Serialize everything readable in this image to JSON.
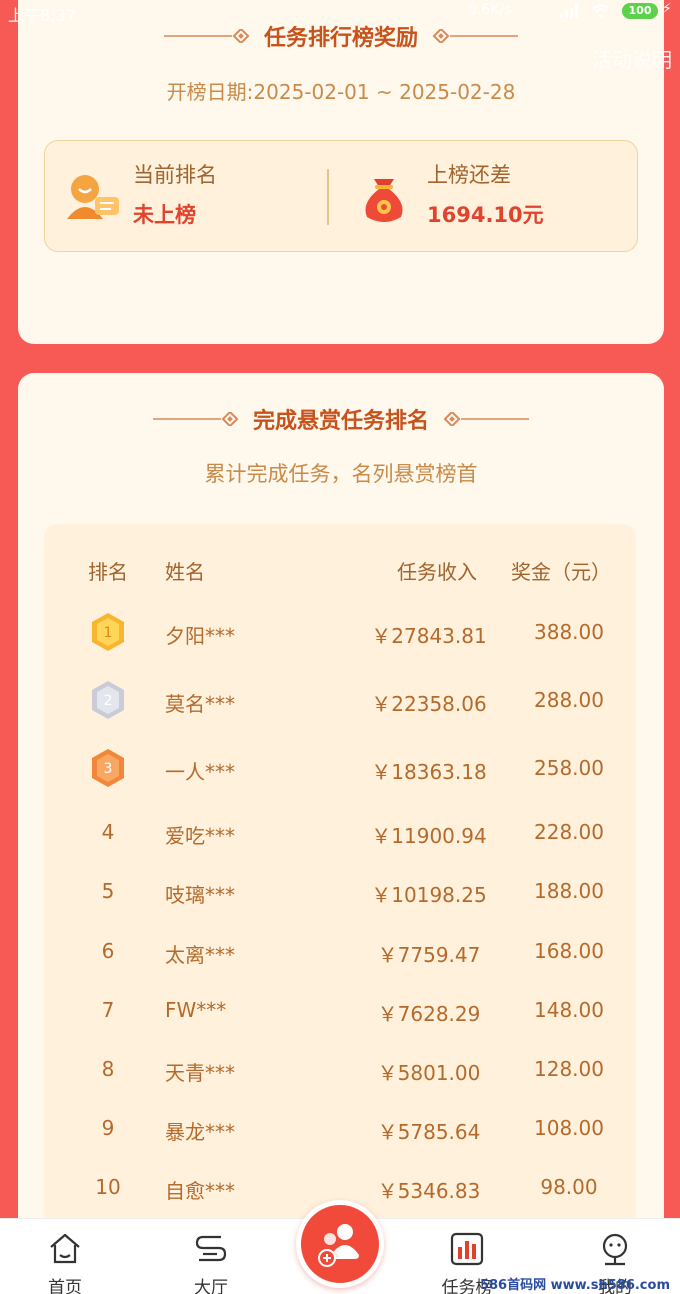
{
  "status": {
    "time": "上午8:37",
    "net": "0.6K/s",
    "battery": "100"
  },
  "help_link": "活动说明",
  "reward": {
    "title": "任务排行榜奖励",
    "date_line": "开榜日期:2025-02-01 ~ 2025-02-28",
    "current_rank_label": "当前排名",
    "current_rank_value": "未上榜",
    "gap_label": "上榜还差",
    "gap_value": "1694.10元"
  },
  "ranking": {
    "title": "完成悬赏任务排名",
    "subtitle": "累计完成任务，名列悬赏榜首",
    "headers": {
      "rank": "排名",
      "name": "姓名",
      "income": "任务收入",
      "bonus": "奖金（元）"
    },
    "rows": [
      {
        "rank": "1",
        "name": "夕阳***",
        "income": "￥27843.81",
        "bonus": "388.00"
      },
      {
        "rank": "2",
        "name": "莫名***",
        "income": "￥22358.06",
        "bonus": "288.00"
      },
      {
        "rank": "3",
        "name": "一人***",
        "income": "￥18363.18",
        "bonus": "258.00"
      },
      {
        "rank": "4",
        "name": "爱吃***",
        "income": "￥11900.94",
        "bonus": "228.00"
      },
      {
        "rank": "5",
        "name": "吱璃***",
        "income": "￥10198.25",
        "bonus": "188.00"
      },
      {
        "rank": "6",
        "name": "太离***",
        "income": "￥7759.47",
        "bonus": "168.00"
      },
      {
        "rank": "7",
        "name": "FW***",
        "income": "￥7628.29",
        "bonus": "148.00"
      },
      {
        "rank": "8",
        "name": "天青***",
        "income": "￥5801.00",
        "bonus": "128.00"
      },
      {
        "rank": "9",
        "name": "暴龙***",
        "income": "￥5785.64",
        "bonus": "108.00"
      },
      {
        "rank": "10",
        "name": "自愈***",
        "income": "￥5346.83",
        "bonus": "98.00"
      }
    ]
  },
  "tabs": [
    {
      "label": "首页",
      "icon": "home-icon"
    },
    {
      "label": "大厅",
      "icon": "hall-icon"
    },
    {
      "label": "任务榜",
      "icon": "ranking-icon"
    },
    {
      "label": "我的",
      "icon": "profile-icon"
    }
  ],
  "fab_icon": "publish-task-icon",
  "watermark": "586首码网 www.sh586.com",
  "colors": {
    "background": "#f75a54",
    "card": "#fff8ec",
    "accent": "#e0442e",
    "title": "#c6521c"
  }
}
